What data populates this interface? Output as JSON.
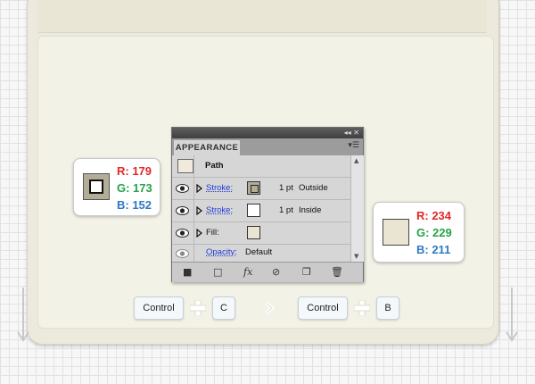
{
  "left_swatch": {
    "r": "R: 179",
    "g": "G: 173",
    "b": "B: 152"
  },
  "right_swatch": {
    "r": "R: 234",
    "g": "G: 229",
    "b": "B: 211"
  },
  "panel": {
    "tab_label": "APPEARANCE",
    "path_label": "Path",
    "rows": [
      {
        "label": "Stroke:",
        "weight": "1 pt",
        "align": "Outside"
      },
      {
        "label": "Stroke:",
        "weight": "1 pt",
        "align": "Inside"
      },
      {
        "label": "Fill:"
      },
      {
        "label": "Opacity:",
        "value": "Default"
      }
    ]
  },
  "shortcuts": [
    {
      "keys": [
        "Control",
        "C"
      ]
    },
    {
      "keys": [
        "Control",
        "B"
      ]
    }
  ],
  "colors": {
    "red": "#e2272b",
    "green": "#27a248",
    "blue": "#2f79c4",
    "stroke_outer": "#b3ad98",
    "fill": "#eae5d3"
  },
  "icons": {
    "eye": "eye-icon",
    "expand": "triangle-right-icon",
    "plus": "plus-icon",
    "then": "chevron-right-icon",
    "fx": "fx-icon",
    "trash": "trash-icon"
  }
}
